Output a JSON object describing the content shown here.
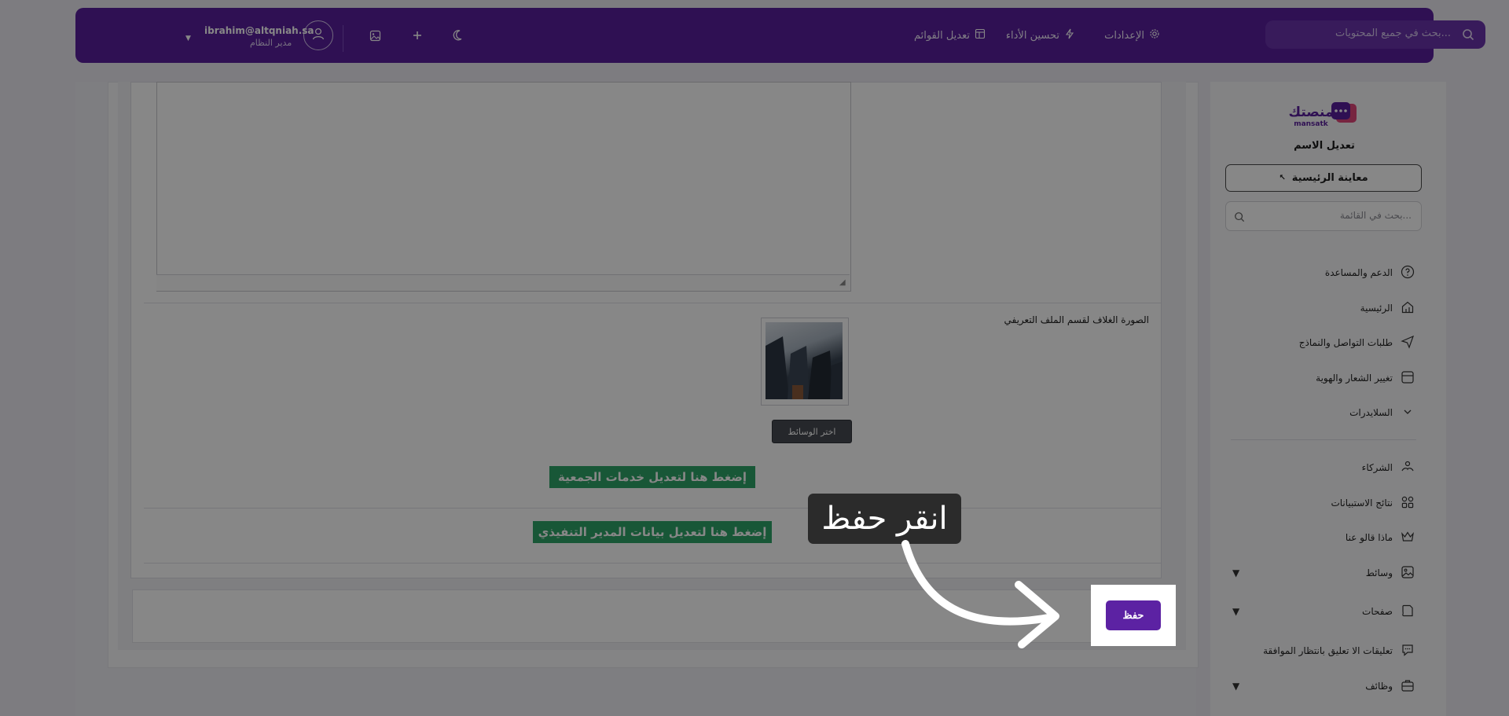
{
  "topbar": {
    "search_placeholder": "بحث في جميع المحتويات...",
    "nav": {
      "settings": "الإعدادات",
      "performance": "تحسين الأداء",
      "edit_menus": "تعديل القوائم"
    },
    "user": {
      "email": "ibrahim@altqniah.sa",
      "role": "مدير النظام"
    }
  },
  "sidebar": {
    "logo_text": "منصتك",
    "logo_sub": "mansatk",
    "site_name": "تعديل الاسم",
    "preview_label": "معاينة الرئيسية",
    "search_placeholder": "بحث في القائمة...",
    "items": [
      {
        "label": "الدعم والمساعدة",
        "icon": "help-circle-icon"
      },
      {
        "label": "الرئيسية",
        "icon": "home-icon"
      },
      {
        "label": "طلبات التواصل والنماذج",
        "icon": "send-icon"
      },
      {
        "label": "تغيير الشعار والهوية",
        "icon": "layout-icon"
      },
      {
        "label": "السلايدرات",
        "icon": "chevron-down-icon"
      },
      {
        "label": "الشركاء",
        "icon": "handshake-icon"
      },
      {
        "label": "نتائج الاستبيانات",
        "icon": "grid-icon"
      },
      {
        "label": "ماذا قالو عنا",
        "icon": "crown-icon"
      },
      {
        "label": "وسائط",
        "icon": "image-icon"
      },
      {
        "label": "صفحات",
        "icon": "pages-icon"
      },
      {
        "label": "تعليقات الا تعليق بانتظار الموافقة",
        "icon": "comment-icon"
      },
      {
        "label": "وظائف",
        "icon": "briefcase-icon"
      }
    ]
  },
  "main": {
    "cover_label": "الصورة الغلاف لقسم الملف التعريفي",
    "choose_media": "اختر الوسائط",
    "link_services": "إضغط هنا لتعديل خدمات الجمعية",
    "link_director": "إضغط هنا لتعديل بيانات المدير التنفيذي",
    "save_label": "حفظ"
  },
  "tutorial": {
    "callout": "انقر حفظ"
  },
  "colors": {
    "brand": "#5a1f9d",
    "accent_green": "#2fa468",
    "save_button": "#5c22a3"
  }
}
